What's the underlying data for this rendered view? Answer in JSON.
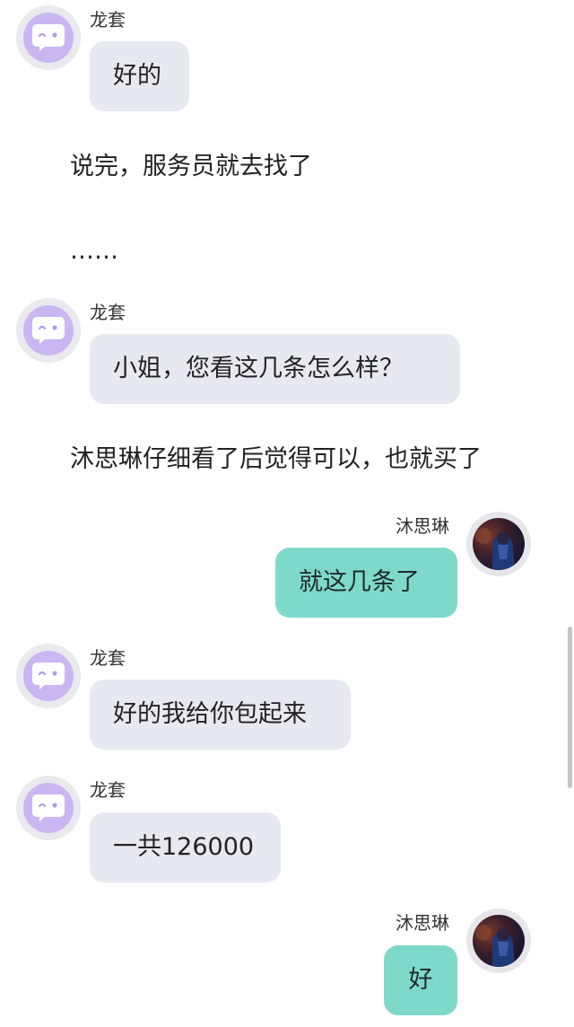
{
  "colors": {
    "bot_bubble": "#e6e9f0",
    "user_bubble": "#7fd9cb",
    "bot_avatar": "#c9b6f2"
  },
  "icons": {
    "bot_avatar": "chat-bubble-face-icon",
    "user_avatar": "user-photo"
  },
  "chat": {
    "m1": {
      "sender": "龙套",
      "text": "好的"
    },
    "n1": {
      "text": "说完，服务员就去找了"
    },
    "n2": {
      "text": "……"
    },
    "m2": {
      "sender": "龙套",
      "text": "小姐，您看这几条怎么样？"
    },
    "n3": {
      "text": "沐思琳仔细看了后觉得可以，也就买了"
    },
    "m3": {
      "sender": "沐思琳",
      "text": "就这几条了"
    },
    "m4": {
      "sender": "龙套",
      "text": "好的我给你包起来"
    },
    "m5": {
      "sender": "龙套",
      "text": "一共126000"
    },
    "m6": {
      "sender": "沐思琳",
      "text": "好"
    }
  }
}
